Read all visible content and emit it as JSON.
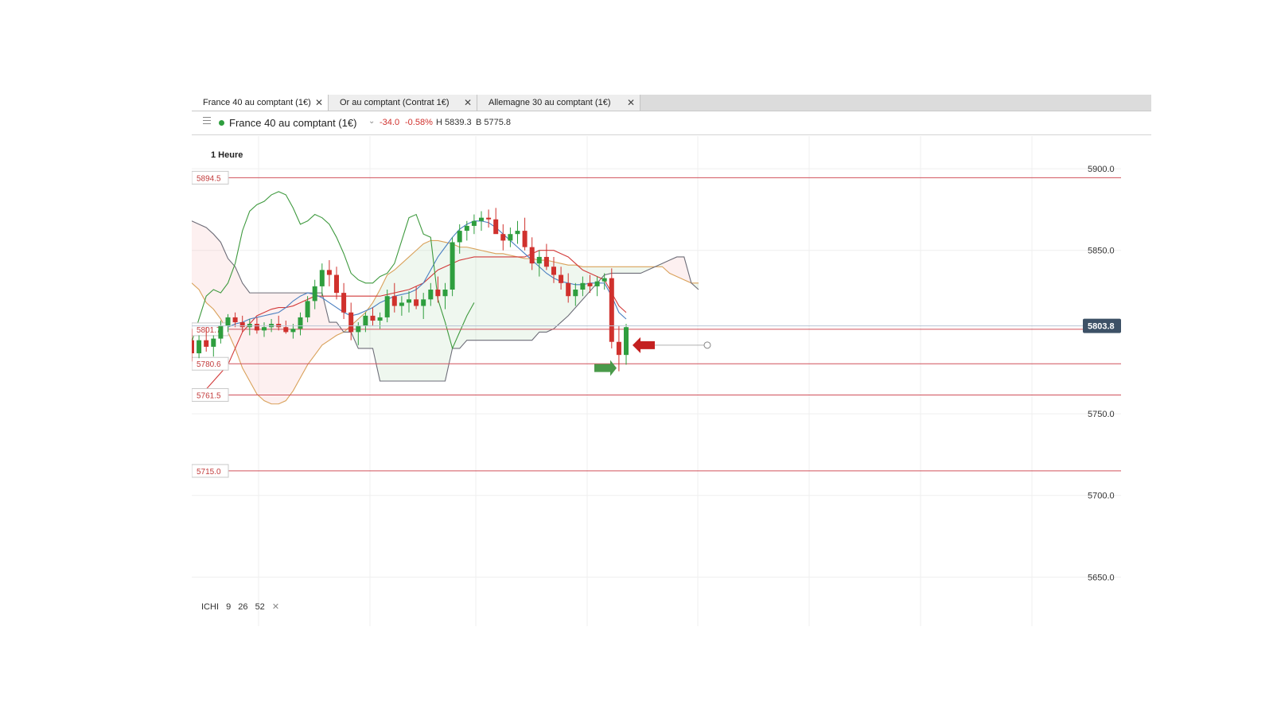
{
  "tabs": [
    {
      "label": "France 40 au comptant (1€)",
      "close": "✕",
      "active": true
    },
    {
      "label": "Or au comptant (Contrat 1€)",
      "close": "✕",
      "active": false
    },
    {
      "label": "Allemagne 30 au comptant (1€)",
      "close": "✕",
      "active": false
    }
  ],
  "header": {
    "instrument": "France 40 au comptant (1€)",
    "change": "-34.0",
    "change_pct": "-0.58%",
    "high": "H 5839.3",
    "low": "B 5775.8",
    "status_color": "#2e9e3e",
    "negative_color": "#d0312d"
  },
  "timeframe": "1 Heure",
  "indicator": {
    "name": "ICHI",
    "p1": "9",
    "p2": "26",
    "p3": "52",
    "close": "✕"
  },
  "chart_data": {
    "type": "candlestick",
    "ylim": [
      5620,
      5920
    ],
    "yticks": [
      {
        "value": 5900,
        "label": "5900.0"
      },
      {
        "value": 5850,
        "label": "5850.0"
      },
      {
        "value": 5750,
        "label": "5750.0"
      },
      {
        "value": 5700,
        "label": "5700.0"
      },
      {
        "value": 5650,
        "label": "5650.0"
      }
    ],
    "last_price": {
      "value": 5803.8,
      "label": "5803.8"
    },
    "levels": [
      {
        "value": 5894.5,
        "label": "5894.5"
      },
      {
        "value": 5801.7,
        "label": "5801.7"
      },
      {
        "value": 5780.6,
        "label": "5780.6"
      },
      {
        "value": 5761.5,
        "label": "5761.5"
      },
      {
        "value": 5715.0,
        "label": "5715.0"
      }
    ],
    "candles": [
      [
        5795,
        5802,
        5782,
        5787
      ],
      [
        5787,
        5798,
        5784,
        5795
      ],
      [
        5795,
        5803,
        5788,
        5791
      ],
      [
        5791,
        5798,
        5785,
        5796
      ],
      [
        5796,
        5807,
        5793,
        5804
      ],
      [
        5804,
        5811,
        5800,
        5809
      ],
      [
        5809,
        5812,
        5803,
        5806
      ],
      [
        5806,
        5810,
        5800,
        5803
      ],
      [
        5803,
        5808,
        5798,
        5805
      ],
      [
        5805,
        5809,
        5799,
        5801
      ],
      [
        5801,
        5806,
        5797,
        5803
      ],
      [
        5803,
        5808,
        5800,
        5805
      ],
      [
        5805,
        5810,
        5801,
        5803
      ],
      [
        5803,
        5807,
        5799,
        5800
      ],
      [
        5800,
        5805,
        5796,
        5802
      ],
      [
        5802,
        5812,
        5798,
        5809
      ],
      [
        5809,
        5822,
        5806,
        5819
      ],
      [
        5819,
        5832,
        5814,
        5828
      ],
      [
        5828,
        5842,
        5822,
        5838
      ],
      [
        5838,
        5844,
        5828,
        5835
      ],
      [
        5835,
        5840,
        5820,
        5824
      ],
      [
        5824,
        5830,
        5808,
        5812
      ],
      [
        5812,
        5818,
        5795,
        5800
      ],
      [
        5800,
        5806,
        5792,
        5804
      ],
      [
        5804,
        5812,
        5800,
        5810
      ],
      [
        5810,
        5815,
        5804,
        5807
      ],
      [
        5807,
        5812,
        5802,
        5809
      ],
      [
        5809,
        5826,
        5806,
        5822
      ],
      [
        5822,
        5830,
        5812,
        5816
      ],
      [
        5816,
        5822,
        5810,
        5818
      ],
      [
        5818,
        5825,
        5812,
        5820
      ],
      [
        5820,
        5828,
        5814,
        5816
      ],
      [
        5816,
        5824,
        5808,
        5820
      ],
      [
        5820,
        5830,
        5816,
        5826
      ],
      [
        5826,
        5834,
        5818,
        5822
      ],
      [
        5822,
        5830,
        5814,
        5826
      ],
      [
        5826,
        5858,
        5822,
        5855
      ],
      [
        5855,
        5866,
        5848,
        5862
      ],
      [
        5862,
        5868,
        5856,
        5865
      ],
      [
        5865,
        5872,
        5860,
        5868
      ],
      [
        5868,
        5874,
        5862,
        5870
      ],
      [
        5870,
        5875,
        5864,
        5869
      ],
      [
        5869,
        5876,
        5862,
        5860
      ],
      [
        5860,
        5866,
        5850,
        5856
      ],
      [
        5856,
        5864,
        5852,
        5860
      ],
      [
        5860,
        5868,
        5854,
        5862
      ],
      [
        5862,
        5870,
        5850,
        5852
      ],
      [
        5852,
        5858,
        5838,
        5842
      ],
      [
        5842,
        5850,
        5834,
        5846
      ],
      [
        5846,
        5854,
        5838,
        5840
      ],
      [
        5840,
        5846,
        5830,
        5835
      ],
      [
        5835,
        5840,
        5826,
        5830
      ],
      [
        5830,
        5836,
        5818,
        5822
      ],
      [
        5822,
        5830,
        5816,
        5826
      ],
      [
        5826,
        5834,
        5822,
        5830
      ],
      [
        5830,
        5835,
        5824,
        5828
      ],
      [
        5828,
        5834,
        5822,
        5831
      ],
      [
        5831,
        5836,
        5826,
        5833
      ],
      [
        5833,
        5839,
        5790,
        5794
      ],
      [
        5794,
        5804,
        5776,
        5786
      ],
      [
        5786,
        5805,
        5780,
        5803
      ]
    ],
    "ichimoku": {
      "tenkan": [
        5798,
        5799,
        5800,
        5801,
        5802,
        5803,
        5805,
        5806,
        5808,
        5809,
        5810,
        5811,
        5812,
        5815,
        5819,
        5822,
        5824,
        5823,
        5821,
        5818,
        5815,
        5812,
        5810,
        5811,
        5813,
        5815,
        5818,
        5820,
        5822,
        5823,
        5824,
        5826,
        5830,
        5838,
        5846,
        5852,
        5858,
        5863,
        5866,
        5868,
        5868,
        5867,
        5864,
        5860,
        5856,
        5852,
        5848,
        5844,
        5840,
        5836,
        5833,
        5831,
        5830,
        5829,
        5829,
        5830,
        5830,
        5830,
        5822,
        5812,
        5808
      ],
      "kijun": [
        5760,
        5762,
        5765,
        5770,
        5775,
        5780,
        5790,
        5800,
        5805,
        5810,
        5812,
        5814,
        5815,
        5815,
        5816,
        5818,
        5820,
        5822,
        5822,
        5822,
        5822,
        5822,
        5822,
        5822,
        5822,
        5822,
        5822,
        5823,
        5824,
        5825,
        5826,
        5828,
        5830,
        5834,
        5838,
        5840,
        5842,
        5844,
        5845,
        5846,
        5846,
        5846,
        5846,
        5846,
        5846,
        5846,
        5846,
        5848,
        5850,
        5850,
        5850,
        5848,
        5846,
        5842,
        5838,
        5836,
        5834,
        5832,
        5824,
        5816,
        5812
      ],
      "chikou": [
        5794,
        5808,
        5822,
        5826,
        5824,
        5830,
        5842,
        5862,
        5874,
        5878,
        5880,
        5884,
        5886,
        5884,
        5876,
        5866,
        5868,
        5872,
        5870,
        5866,
        5858,
        5848,
        5836,
        5832,
        5830,
        5830,
        5834,
        5836,
        5842,
        5856,
        5870,
        5872,
        5860,
        5858,
        5820,
        5806,
        5790,
        5800,
        5810,
        5818
      ],
      "span_a": [
        5830,
        5826,
        5818,
        5814,
        5808,
        5800,
        5790,
        5778,
        5770,
        5762,
        5758,
        5756,
        5756,
        5758,
        5764,
        5772,
        5780,
        5786,
        5792,
        5795,
        5798,
        5800,
        5804,
        5808,
        5812,
        5818,
        5826,
        5835,
        5838,
        5842,
        5846,
        5850,
        5854,
        5856,
        5856,
        5855,
        5854,
        5852,
        5852,
        5851,
        5850,
        5849,
        5848,
        5848,
        5847,
        5846,
        5845,
        5845,
        5844,
        5844,
        5843,
        5842,
        5841,
        5841,
        5840,
        5840,
        5840,
        5840,
        5840,
        5840,
        5840,
        5840,
        5840,
        5840,
        5840,
        5840,
        5836,
        5834,
        5832,
        5830,
        5830
      ],
      "span_b": [
        5868,
        5866,
        5864,
        5860,
        5855,
        5845,
        5840,
        5830,
        5824,
        5824,
        5824,
        5824,
        5824,
        5824,
        5824,
        5824,
        5824,
        5824,
        5824,
        5806,
        5806,
        5800,
        5800,
        5790,
        5790,
        5790,
        5770,
        5770,
        5770,
        5770,
        5770,
        5770,
        5770,
        5770,
        5770,
        5770,
        5790,
        5790,
        5795,
        5795,
        5795,
        5795,
        5795,
        5795,
        5795,
        5795,
        5795,
        5795,
        5800,
        5800,
        5802,
        5806,
        5810,
        5815,
        5820,
        5825,
        5830,
        5835,
        5836,
        5836,
        5836,
        5836,
        5836,
        5838,
        5840,
        5842,
        5844,
        5846,
        5846,
        5830,
        5826
      ]
    },
    "markers": [
      {
        "type": "entry-arrow",
        "direction": "right",
        "color": "#4a9a4a",
        "value": 5778
      },
      {
        "type": "exit-arrow",
        "direction": "left",
        "color": "#c42020",
        "value": 5792
      }
    ]
  }
}
